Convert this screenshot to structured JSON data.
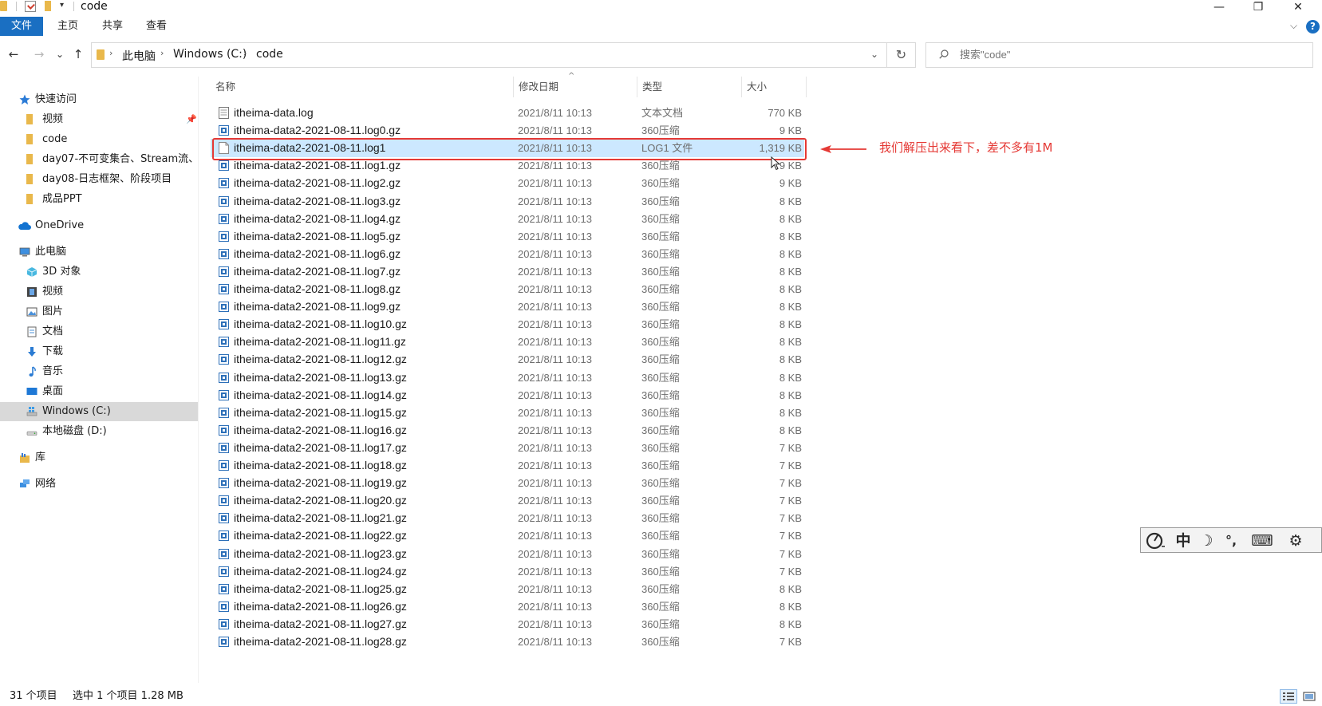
{
  "window": {
    "title": "code",
    "quick_access_dropdown": "▾",
    "minimize": "—",
    "maximize": "❐",
    "close": "✕"
  },
  "ribbon": {
    "tabs": [
      "文件",
      "主页",
      "共享",
      "查看"
    ],
    "collapse_chevron": "⌵",
    "help": "?"
  },
  "address": {
    "back": "←",
    "forward": "→",
    "recent": "⌄",
    "up": "↑",
    "breadcrumbs": [
      "此电脑",
      "Windows (C:)",
      "code"
    ],
    "crumb_separator": "›",
    "dropdown": "⌄",
    "refresh": "↻"
  },
  "search": {
    "placeholder": "搜索\"code\""
  },
  "sidebar": {
    "quick_access": "快速访问",
    "quick_items": [
      "视频",
      "code",
      "day07-不可变集合、Stream流、!",
      "day08-日志框架、阶段项目",
      "成品PPT"
    ],
    "onedrive": "OneDrive",
    "this_pc": "此电脑",
    "pc_items": [
      "3D 对象",
      "视频",
      "图片",
      "文档",
      "下载",
      "音乐",
      "桌面",
      "Windows (C:)",
      "本地磁盘 (D:)"
    ],
    "libraries": "库",
    "network": "网络"
  },
  "columns": {
    "name": "名称",
    "date": "修改日期",
    "type": "类型",
    "size": "大小",
    "sort_indicator": "^"
  },
  "files": [
    {
      "name": "itheima-data.log",
      "date": "2021/8/11 10:13",
      "type": "文本文档",
      "size": "770 KB",
      "icon": "text-file-icon"
    },
    {
      "name": "itheima-data2-2021-08-11.log0.gz",
      "date": "2021/8/11 10:13",
      "type": "360压缩",
      "size": "9 KB",
      "icon": "archive-icon"
    },
    {
      "name": "itheima-data2-2021-08-11.log1",
      "date": "2021/8/11 10:13",
      "type": "LOG1 文件",
      "size": "1,319 KB",
      "icon": "blank-file-icon",
      "selected": true
    },
    {
      "name": "itheima-data2-2021-08-11.log1.gz",
      "date": "2021/8/11 10:13",
      "type": "360压缩",
      "size": "9 KB",
      "icon": "archive-icon"
    },
    {
      "name": "itheima-data2-2021-08-11.log2.gz",
      "date": "2021/8/11 10:13",
      "type": "360压缩",
      "size": "9 KB",
      "icon": "archive-icon"
    },
    {
      "name": "itheima-data2-2021-08-11.log3.gz",
      "date": "2021/8/11 10:13",
      "type": "360压缩",
      "size": "8 KB",
      "icon": "archive-icon"
    },
    {
      "name": "itheima-data2-2021-08-11.log4.gz",
      "date": "2021/8/11 10:13",
      "type": "360压缩",
      "size": "8 KB",
      "icon": "archive-icon"
    },
    {
      "name": "itheima-data2-2021-08-11.log5.gz",
      "date": "2021/8/11 10:13",
      "type": "360压缩",
      "size": "8 KB",
      "icon": "archive-icon"
    },
    {
      "name": "itheima-data2-2021-08-11.log6.gz",
      "date": "2021/8/11 10:13",
      "type": "360压缩",
      "size": "8 KB",
      "icon": "archive-icon"
    },
    {
      "name": "itheima-data2-2021-08-11.log7.gz",
      "date": "2021/8/11 10:13",
      "type": "360压缩",
      "size": "8 KB",
      "icon": "archive-icon"
    },
    {
      "name": "itheima-data2-2021-08-11.log8.gz",
      "date": "2021/8/11 10:13",
      "type": "360压缩",
      "size": "8 KB",
      "icon": "archive-icon"
    },
    {
      "name": "itheima-data2-2021-08-11.log9.gz",
      "date": "2021/8/11 10:13",
      "type": "360压缩",
      "size": "8 KB",
      "icon": "archive-icon"
    },
    {
      "name": "itheima-data2-2021-08-11.log10.gz",
      "date": "2021/8/11 10:13",
      "type": "360压缩",
      "size": "8 KB",
      "icon": "archive-icon"
    },
    {
      "name": "itheima-data2-2021-08-11.log11.gz",
      "date": "2021/8/11 10:13",
      "type": "360压缩",
      "size": "8 KB",
      "icon": "archive-icon"
    },
    {
      "name": "itheima-data2-2021-08-11.log12.gz",
      "date": "2021/8/11 10:13",
      "type": "360压缩",
      "size": "8 KB",
      "icon": "archive-icon"
    },
    {
      "name": "itheima-data2-2021-08-11.log13.gz",
      "date": "2021/8/11 10:13",
      "type": "360压缩",
      "size": "8 KB",
      "icon": "archive-icon"
    },
    {
      "name": "itheima-data2-2021-08-11.log14.gz",
      "date": "2021/8/11 10:13",
      "type": "360压缩",
      "size": "8 KB",
      "icon": "archive-icon"
    },
    {
      "name": "itheima-data2-2021-08-11.log15.gz",
      "date": "2021/8/11 10:13",
      "type": "360压缩",
      "size": "8 KB",
      "icon": "archive-icon"
    },
    {
      "name": "itheima-data2-2021-08-11.log16.gz",
      "date": "2021/8/11 10:13",
      "type": "360压缩",
      "size": "8 KB",
      "icon": "archive-icon"
    },
    {
      "name": "itheima-data2-2021-08-11.log17.gz",
      "date": "2021/8/11 10:13",
      "type": "360压缩",
      "size": "7 KB",
      "icon": "archive-icon"
    },
    {
      "name": "itheima-data2-2021-08-11.log18.gz",
      "date": "2021/8/11 10:13",
      "type": "360压缩",
      "size": "7 KB",
      "icon": "archive-icon"
    },
    {
      "name": "itheima-data2-2021-08-11.log19.gz",
      "date": "2021/8/11 10:13",
      "type": "360压缩",
      "size": "7 KB",
      "icon": "archive-icon"
    },
    {
      "name": "itheima-data2-2021-08-11.log20.gz",
      "date": "2021/8/11 10:13",
      "type": "360压缩",
      "size": "7 KB",
      "icon": "archive-icon"
    },
    {
      "name": "itheima-data2-2021-08-11.log21.gz",
      "date": "2021/8/11 10:13",
      "type": "360压缩",
      "size": "7 KB",
      "icon": "archive-icon"
    },
    {
      "name": "itheima-data2-2021-08-11.log22.gz",
      "date": "2021/8/11 10:13",
      "type": "360压缩",
      "size": "7 KB",
      "icon": "archive-icon"
    },
    {
      "name": "itheima-data2-2021-08-11.log23.gz",
      "date": "2021/8/11 10:13",
      "type": "360压缩",
      "size": "7 KB",
      "icon": "archive-icon"
    },
    {
      "name": "itheima-data2-2021-08-11.log24.gz",
      "date": "2021/8/11 10:13",
      "type": "360压缩",
      "size": "7 KB",
      "icon": "archive-icon"
    },
    {
      "name": "itheima-data2-2021-08-11.log25.gz",
      "date": "2021/8/11 10:13",
      "type": "360压缩",
      "size": "8 KB",
      "icon": "archive-icon"
    },
    {
      "name": "itheima-data2-2021-08-11.log26.gz",
      "date": "2021/8/11 10:13",
      "type": "360压缩",
      "size": "8 KB",
      "icon": "archive-icon"
    },
    {
      "name": "itheima-data2-2021-08-11.log27.gz",
      "date": "2021/8/11 10:13",
      "type": "360压缩",
      "size": "8 KB",
      "icon": "archive-icon"
    },
    {
      "name": "itheima-data2-2021-08-11.log28.gz",
      "date": "2021/8/11 10:13",
      "type": "360压缩",
      "size": "7 KB",
      "icon": "archive-icon"
    }
  ],
  "annotation": {
    "text": "我们解压出来看下，差不多有1M",
    "color": "#e53935"
  },
  "ime": {
    "mode": "中",
    "moon": "☽",
    "punct": "°,",
    "keyboard": "⌨",
    "settings": "⚙"
  },
  "status": {
    "item_count": "31 个项目",
    "selection": "选中 1 个项目  1.28 MB"
  },
  "colors": {
    "accent": "#1a6fc2",
    "selection": "#cce8ff",
    "folder": "#e9b84b"
  }
}
